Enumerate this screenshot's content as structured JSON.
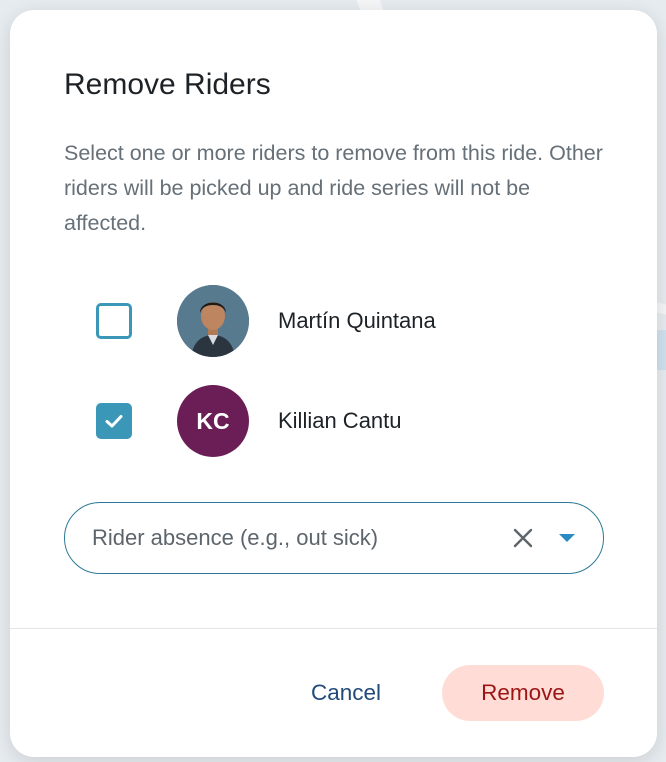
{
  "dialog": {
    "title": "Remove Riders",
    "description": "Select one or more riders to remove from this ride. Other riders will be picked up and ride series will not be affected."
  },
  "riders": [
    {
      "name": "Martín Quintana",
      "checked": false,
      "avatar": "photo"
    },
    {
      "name": "Killian Cantu",
      "checked": true,
      "avatar": "initials",
      "initials": "KC",
      "avatar_color": "#6b1d55"
    }
  ],
  "reason": {
    "value": "Rider absence (e.g., out sick)"
  },
  "actions": {
    "cancel_label": "Cancel",
    "remove_label": "Remove"
  },
  "colors": {
    "accent": "#3a97b7",
    "cancel_text": "#224a7a",
    "remove_bg": "#ffdcd6",
    "remove_text": "#9b1515"
  },
  "icons": [
    "check-icon",
    "clear-icon",
    "dropdown-arrow-icon"
  ]
}
